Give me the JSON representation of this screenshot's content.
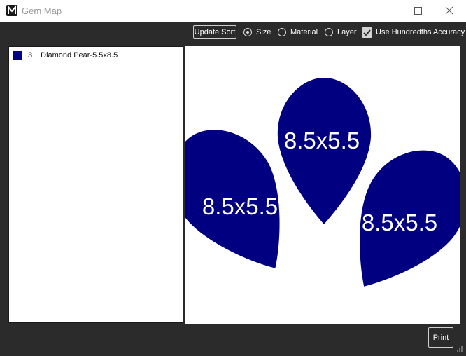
{
  "window": {
    "title": "Gem Map"
  },
  "toolbar": {
    "update_sort_label": "Update Sort",
    "sort_options": [
      {
        "label": "Size",
        "selected": true
      },
      {
        "label": "Material",
        "selected": false
      },
      {
        "label": "Layer",
        "selected": false
      }
    ],
    "hundredths_label": "Use Hundredths Accuracy",
    "hundredths_checked": true
  },
  "legend": {
    "items": [
      {
        "count": "3",
        "name": "Diamond Pear-5.5x8.5",
        "color": "#000080"
      }
    ]
  },
  "gem_map": {
    "gem_color": "#000080",
    "label_color": "#ffffff",
    "gems": [
      {
        "label": "8.5x5.5"
      },
      {
        "label": "8.5x5.5"
      },
      {
        "label": "8.5x5.5"
      }
    ]
  },
  "footer": {
    "print_label": "Print"
  },
  "colors": {
    "background": "#2b2b2b",
    "panel": "#ffffff",
    "accent": "#000080"
  }
}
